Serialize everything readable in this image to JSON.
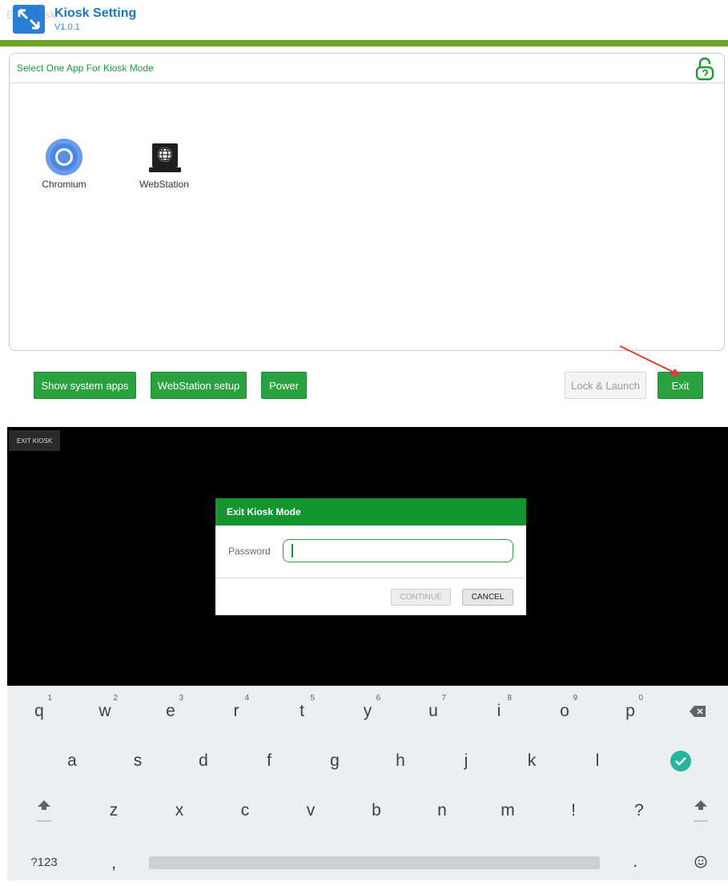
{
  "header": {
    "ghost_text": "Exit Kiosk",
    "title": "Kiosk Setting",
    "version": "V1.0.1"
  },
  "panel": {
    "title": "Select One App For Kiosk Mode",
    "apps": [
      {
        "label": "Chromium",
        "icon": "chromium-icon"
      },
      {
        "label": "WebStation",
        "icon": "webstation-icon"
      }
    ]
  },
  "actions": {
    "show_system_apps": "Show system apps",
    "webstation_setup": "WebStation setup",
    "power": "Power",
    "lock_launch": "Lock & Launch",
    "exit": "Exit"
  },
  "exit_screen": {
    "tag": "EXIT KIOSK",
    "dialog": {
      "title": "Exit Kiosk Mode",
      "password_label": "Password",
      "password_value": "",
      "continue": "CONTINUE",
      "cancel": "CANCEL"
    }
  },
  "keyboard": {
    "row1": [
      {
        "k": "q",
        "hint": "1"
      },
      {
        "k": "w",
        "hint": "2"
      },
      {
        "k": "e",
        "hint": "3"
      },
      {
        "k": "r",
        "hint": "4"
      },
      {
        "k": "t",
        "hint": "5"
      },
      {
        "k": "y",
        "hint": "6"
      },
      {
        "k": "u",
        "hint": "7"
      },
      {
        "k": "i",
        "hint": "8"
      },
      {
        "k": "o",
        "hint": "9"
      },
      {
        "k": "p",
        "hint": "0"
      }
    ],
    "row2": [
      "a",
      "s",
      "d",
      "f",
      "g",
      "h",
      "j",
      "k",
      "l"
    ],
    "row3": [
      "z",
      "x",
      "c",
      "v",
      "b",
      "n",
      "m",
      "!",
      "?"
    ],
    "symbols": "?123",
    "comma": ",",
    "period": "."
  },
  "colors": {
    "brand_green": "#2aa23f",
    "header_bar": "#6da122",
    "dialog_header": "#13952f",
    "title_blue": "#1976c9",
    "arrow_red": "#e53935"
  }
}
